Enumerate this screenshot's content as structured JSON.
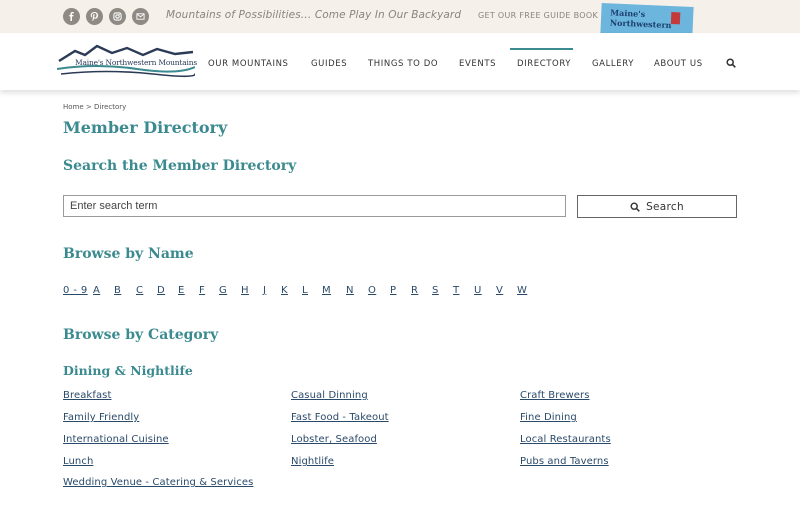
{
  "topbar": {
    "social_icons": [
      "facebook-icon",
      "pinterest-icon",
      "instagram-icon",
      "email-icon"
    ],
    "tagline": "Mountains of Possibilities… Come Play In Our Backyard",
    "guide_link": "GET OUR FREE GUIDE BOOK",
    "guide_book_text_1": "Maine's",
    "guide_book_text_2": "Northwestern"
  },
  "header": {
    "logo_text": "Maine's Northwestern Mountains",
    "nav": [
      {
        "label": "OUR MOUNTAINS"
      },
      {
        "label": "GUIDES"
      },
      {
        "label": "THINGS TO DO"
      },
      {
        "label": "EVENTS"
      },
      {
        "label": "DIRECTORY"
      },
      {
        "label": "GALLERY"
      },
      {
        "label": "ABOUT US"
      }
    ],
    "active_nav": "DIRECTORY",
    "search_icon": "search-icon"
  },
  "breadcrumb": {
    "home": "Home",
    "separator": ">",
    "current": "Directory"
  },
  "page_title": "Member Directory",
  "search": {
    "heading": "Search the Member Directory",
    "placeholder": "Enter search term",
    "button_label": "Search"
  },
  "browse_name": {
    "heading": "Browse by Name",
    "letters": [
      "0 - 9",
      "A",
      "B",
      "C",
      "D",
      "E",
      "F",
      "G",
      "H",
      "J",
      "K",
      "L",
      "M",
      "N",
      "O",
      "P",
      "R",
      "S",
      "T",
      "U",
      "V",
      "W"
    ]
  },
  "browse_category": {
    "heading": "Browse by Category",
    "subheading": "Dining & Nightlife",
    "items": [
      "Breakfast",
      "Casual Dinning",
      "Craft Brewers",
      "Family Friendly",
      "Fast Food - Takeout",
      "Fine Dining",
      "International Cuisine",
      "Lobster, Seafood",
      "Local Restaurants",
      "Lunch",
      "Nightlife",
      "Pubs and Taverns",
      "Wedding Venue - Catering & Services"
    ]
  },
  "colors": {
    "accent": "#3a8a8f",
    "link": "#2a4a6a",
    "topbar_bg": "#f6f0eb"
  }
}
